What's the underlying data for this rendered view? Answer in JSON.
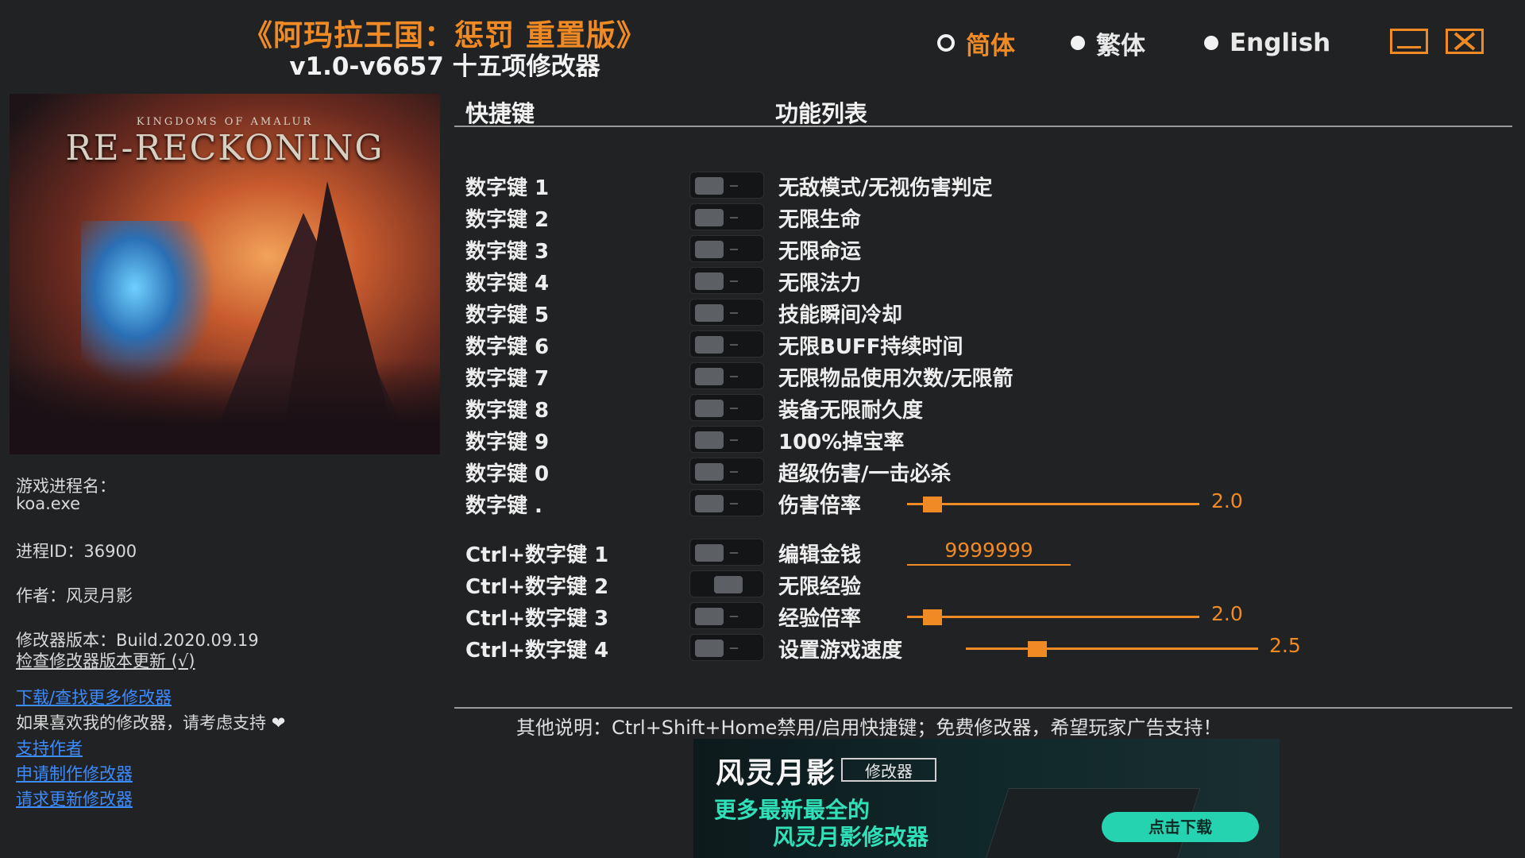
{
  "header": {
    "title": "《阿玛拉王国：惩罚 重置版》",
    "subtitle": "v1.0-v6657 十五项修改器"
  },
  "languages": [
    {
      "label": "简体",
      "selected": true
    },
    {
      "label": "繁体",
      "selected": false
    },
    {
      "label": "English",
      "selected": false
    }
  ],
  "colors": {
    "accent": "#f08a24",
    "background": "#202224",
    "link": "#3d8bff",
    "ad_text": "#2fe0b8"
  },
  "cover": {
    "logo_small": "KINGDOMS OF AMALUR",
    "logo_big": "RE-RECKONING"
  },
  "info": {
    "process_label": "游戏进程名：",
    "process_name": "koa.exe",
    "pid": "进程ID：36900",
    "author": "作者：风灵月影",
    "version": "修改器版本：Build.2020.09.19",
    "check_update": "检查修改器版本更新 (√)",
    "more_trainers": "下载/查找更多修改器",
    "support_text": "如果喜欢我的修改器，请考虑支持",
    "support_author": "支持作者",
    "request_make": "申请制作修改器",
    "request_update": "请求更新修改器"
  },
  "columns": {
    "hotkey": "快捷键",
    "functions": "功能列表"
  },
  "cheats": [
    {
      "key": "数字键 1",
      "name": "无敌模式/无视伤害判定"
    },
    {
      "key": "数字键 2",
      "name": "无限生命"
    },
    {
      "key": "数字键 3",
      "name": "无限命运"
    },
    {
      "key": "数字键 4",
      "name": "无限法力"
    },
    {
      "key": "数字键 5",
      "name": "技能瞬间冷却"
    },
    {
      "key": "数字键 6",
      "name": "无限BUFF持续时间"
    },
    {
      "key": "数字键 7",
      "name": "无限物品使用次数/无限箭"
    },
    {
      "key": "数字键 8",
      "name": "装备无限耐久度"
    },
    {
      "key": "数字键 9",
      "name": "100%掉宝率"
    },
    {
      "key": "数字键 0",
      "name": "超级伤害/一击必杀"
    },
    {
      "key": "数字键 .",
      "name": "伤害倍率",
      "slider_value": "2.0"
    },
    {
      "key": "Ctrl+数字键 1",
      "name": "编辑金钱",
      "input_value": "9999999"
    },
    {
      "key": "Ctrl+数字键 2",
      "name": "无限经验"
    },
    {
      "key": "Ctrl+数字键 3",
      "name": "经验倍率",
      "slider_value": "2.0"
    },
    {
      "key": "Ctrl+数字键 4",
      "name": "设置游戏速度",
      "slider_value": "2.5"
    }
  ],
  "footer": {
    "note": "其他说明：Ctrl+Shift+Home禁用/启用快捷键；免费修改器，希望玩家广告支持！"
  },
  "ad": {
    "brand": "风灵月影",
    "brand_tag": "修改器",
    "line1": "更多最新最全的",
    "line2": "风灵月影修改器",
    "cta": "点击下载"
  }
}
